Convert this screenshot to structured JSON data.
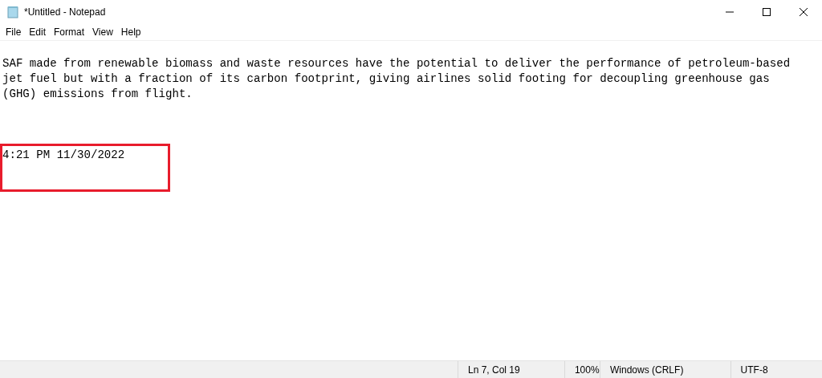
{
  "window": {
    "title": "*Untitled - Notepad"
  },
  "menu": [
    "File",
    "Edit",
    "Format",
    "View",
    "Help"
  ],
  "editor": {
    "paragraph": [
      "SAF made from renewable biomass and waste resources have the potential to deliver the performance of petroleum-based",
      "jet fuel but with a fraction of its carbon footprint, giving airlines solid footing for decoupling greenhouse gas",
      "(GHG) emissions from flight."
    ],
    "timestamp": "4:21 PM 11/30/2022"
  },
  "status_bar": [
    "Ln 7, Col 19",
    "100%",
    "Windows (CRLF)",
    "UTF-8"
  ]
}
